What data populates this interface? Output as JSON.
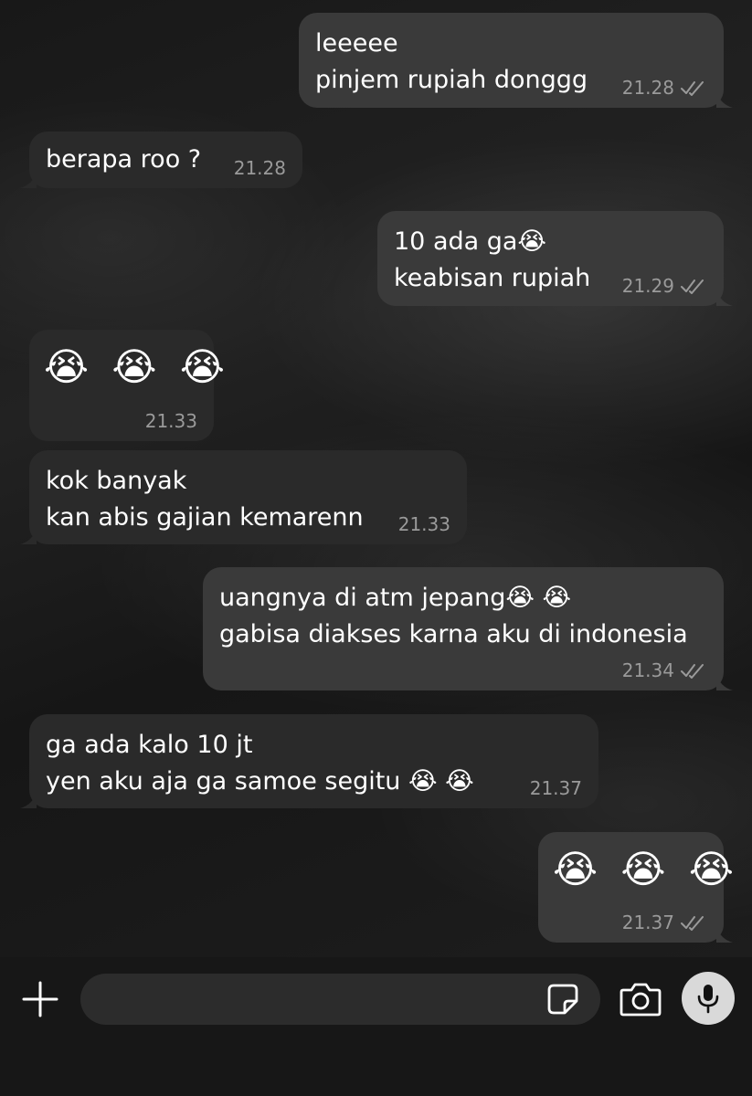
{
  "chat": {
    "messages": [
      {
        "dir": "out",
        "lines": [
          "leeeee",
          "pinjem rupiah donggg"
        ],
        "time": "21.28",
        "read": true
      },
      {
        "dir": "in",
        "lines": [
          "berapa roo ?"
        ],
        "time": "21.28"
      },
      {
        "dir": "out",
        "lines": [
          "10 ada ga😭",
          "keabisan rupiah"
        ],
        "time": "21.29",
        "read": true
      },
      {
        "dir": "in",
        "lines": [
          "😭 😭 😭"
        ],
        "time": "21.33"
      },
      {
        "dir": "in",
        "lines": [
          "kok banyak",
          "kan abis gajian kemarenn"
        ],
        "time": "21.33"
      },
      {
        "dir": "out",
        "lines": [
          "uangnya di atm jepang😭 😭",
          "gabisa diakses karna aku di indonesia"
        ],
        "time": "21.34",
        "read": true
      },
      {
        "dir": "in",
        "lines": [
          "ga ada kalo 10 jt",
          "yen aku aja ga samoe segitu  😭 😭"
        ],
        "time": "21.37"
      },
      {
        "dir": "out",
        "lines": [
          "😭 😭 😭"
        ],
        "time": "21.37",
        "read": true
      }
    ]
  },
  "composer": {
    "input_value": "",
    "icons": [
      "plus-icon",
      "sticker-icon",
      "camera-icon",
      "microphone-icon"
    ]
  },
  "colors": {
    "incoming_bubble": "#2a2a2a",
    "outgoing_bubble": "#3a3a3a",
    "timestamp": "#9a9a9a",
    "bottom_bar": "#171717"
  }
}
